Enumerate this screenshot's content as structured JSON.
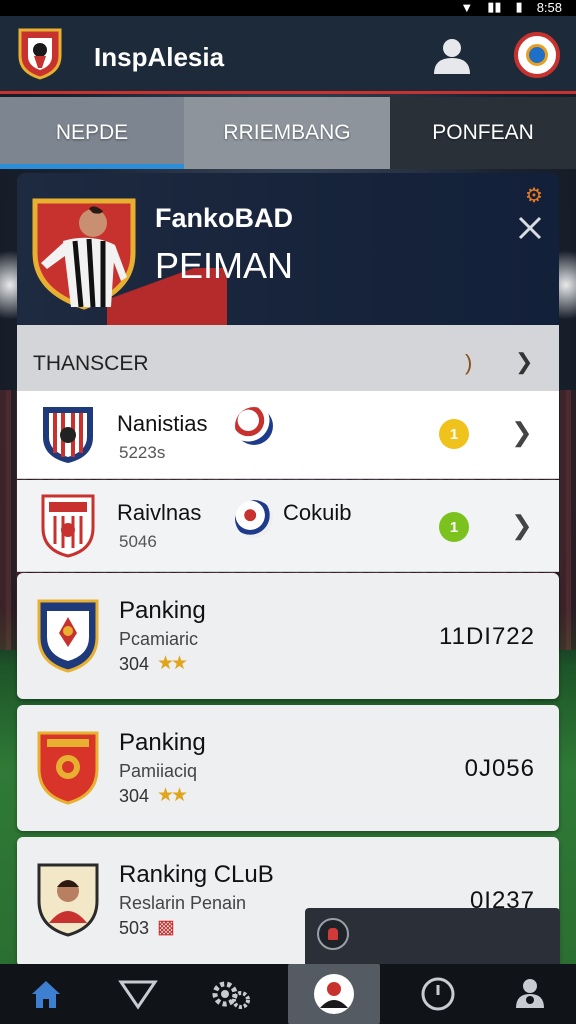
{
  "status_bar": {
    "time": "8:58"
  },
  "header": {
    "app_title": "InspAlesia",
    "logo_icon": "club-crest-icon",
    "user_icon": "user-profile-icon",
    "notification_icon": "notification-ball-icon"
  },
  "tabs": [
    {
      "label": "NEPDE",
      "active": true
    },
    {
      "label": "RRIEMBANG",
      "active": false
    },
    {
      "label": "PONFEAN",
      "active": false
    }
  ],
  "profile": {
    "name_line1": "FankoBAD",
    "name_line2": "PEIMAN",
    "settings_icon": "gear-icon",
    "close_icon": "close-icon"
  },
  "transfer": {
    "title": "THANSCER",
    "paren": ")"
  },
  "transfer_rows": [
    {
      "name": "Nanistias",
      "sub": "5223s",
      "extra": "",
      "pill": "1",
      "pill_color": "#f0c21c"
    },
    {
      "name": "Raivlnas",
      "sub": "5046",
      "extra": "Cokuib",
      "pill": "1",
      "pill_color": "#7cc21e"
    }
  ],
  "ranking_cards": [
    {
      "title": "Panking",
      "subtitle": "Pcamiaric",
      "number": "304",
      "stars": "★★",
      "value": "11DI722"
    },
    {
      "title": "Panking",
      "subtitle": "Pamiiaciq",
      "number": "304",
      "stars": "★★",
      "value": "0J056"
    },
    {
      "title": "Ranking CLuB",
      "subtitle": "Reslarin Penain",
      "number": "503",
      "stars": "▩",
      "value": "0I237"
    }
  ],
  "bottom_nav": [
    {
      "icon": "home-icon",
      "active": false
    },
    {
      "icon": "triangle-icon",
      "active": false
    },
    {
      "icon": "settings-gears-icon",
      "active": false
    },
    {
      "icon": "player-profile-icon",
      "active": true
    },
    {
      "icon": "clock-icon",
      "active": false
    },
    {
      "icon": "team-icon",
      "active": false
    }
  ],
  "colors": {
    "accent_red": "#c8322e",
    "header_bg": "#1d2a3a",
    "tab_indicator": "#2a8fd8",
    "star_gold": "#e0a51c"
  }
}
